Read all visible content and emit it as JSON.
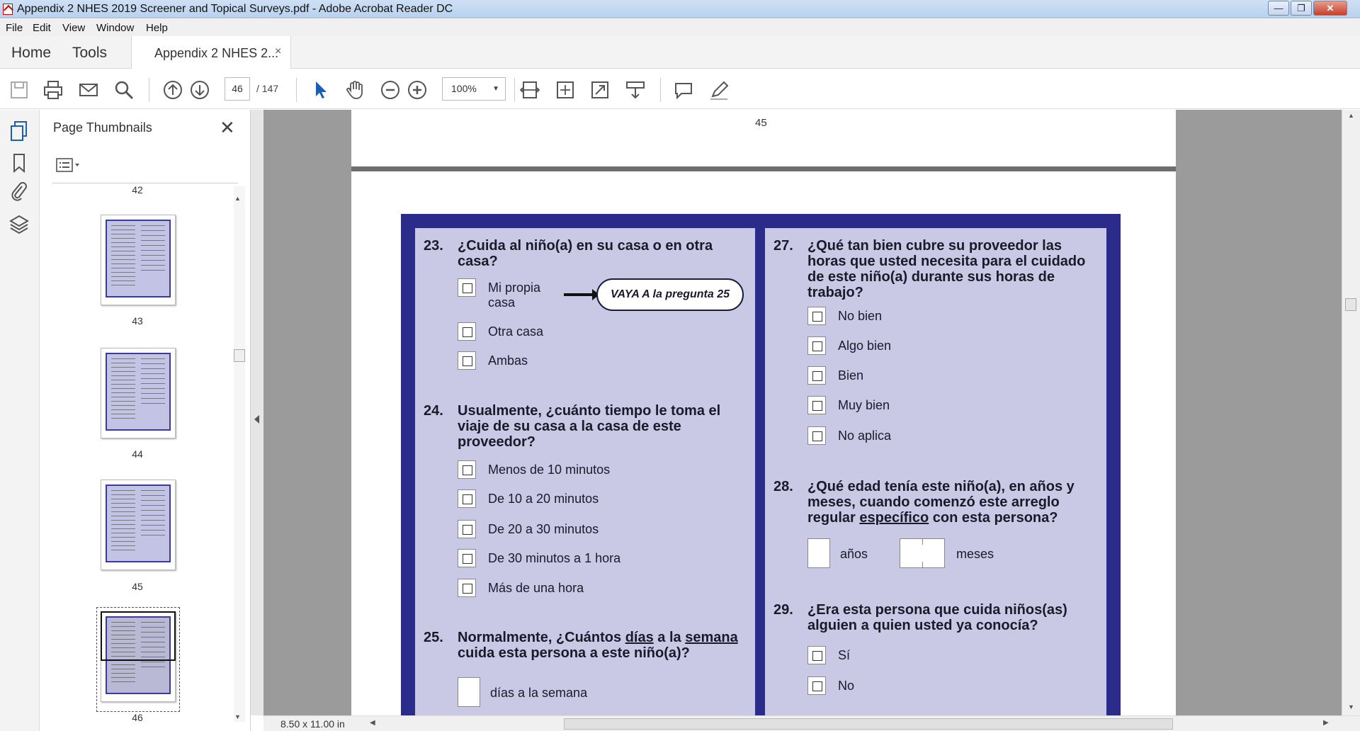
{
  "window": {
    "title": "Appendix 2 NHES 2019 Screener and Topical Surveys.pdf - Adobe Acrobat Reader DC",
    "controls": [
      "—",
      "❐",
      "✕"
    ]
  },
  "menu": [
    "File",
    "Edit",
    "View",
    "Window",
    "Help"
  ],
  "tabs": {
    "home": "Home",
    "tools": "Tools",
    "document": "Appendix 2 NHES 2...",
    "close": "×"
  },
  "toolbar": {
    "page_current": "46",
    "page_total": "/ 147",
    "zoom": "100%",
    "zoom_caret": "▼"
  },
  "thumbnails": {
    "title": "Page Thumbnails",
    "close": "✕",
    "pages": [
      {
        "label": "42"
      },
      {
        "label": "43"
      },
      {
        "label": "44"
      },
      {
        "label": "45"
      },
      {
        "label": "46"
      }
    ]
  },
  "document": {
    "page_number_header": "45",
    "questions": [
      {
        "num": "23.",
        "text": "¿Cuida al niño(a) en su casa o en otra casa?",
        "options": [
          "Mi propia casa",
          "Otra casa",
          "Ambas"
        ],
        "skip": "VAYA A la pregunta 25"
      },
      {
        "num": "24.",
        "text": "Usualmente, ¿cuánto tiempo le toma el viaje de su casa a la casa de este proveedor?",
        "options": [
          "Menos de 10 minutos",
          "De 10 a 20 minutos",
          "De 20 a 30 minutos",
          "De 30 minutos a 1 hora",
          "Más de una hora"
        ]
      },
      {
        "num": "25.",
        "text_parts": [
          "Normalmente, ¿Cuántos ",
          "días",
          " a la ",
          "semana",
          " cuida esta persona a este niño(a)?"
        ],
        "box_label": "días a la semana"
      },
      {
        "num": "27.",
        "text": "¿Qué tan bien cubre su proveedor las horas que usted necesita para el cuidado de este niño(a) durante sus horas de trabajo?",
        "options": [
          "No bien",
          "Algo bien",
          "Bien",
          "Muy bien",
          "No aplica"
        ]
      },
      {
        "num": "28.",
        "text_parts": [
          "¿Qué edad tenía este niño(a), en años y meses, cuando comenzó este arreglo regular ",
          "específico",
          " con esta persona?"
        ],
        "label_years": "años",
        "label_months": "meses"
      },
      {
        "num": "29.",
        "text": "¿Era esta persona que cuida niños(as) alguien a quien usted ya conocía?",
        "options": [
          "Sí",
          "No"
        ]
      }
    ]
  },
  "status": {
    "page_size": "8.50 x 11.00 in"
  }
}
